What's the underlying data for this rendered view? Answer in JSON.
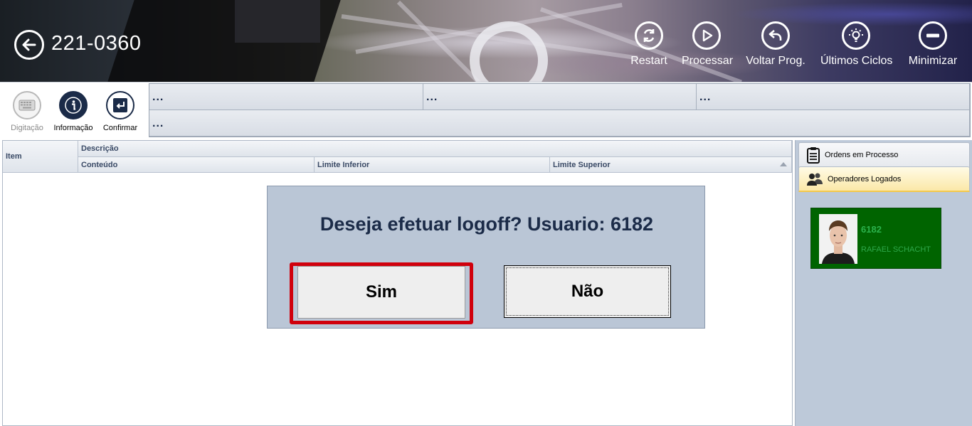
{
  "header": {
    "title": "221-0360",
    "buttons": [
      {
        "label": "Restart",
        "icon": "restart-icon"
      },
      {
        "label": "Processar",
        "icon": "play-icon"
      },
      {
        "label": "Voltar Prog.",
        "icon": "undo-icon"
      },
      {
        "label": "Últimos Ciclos",
        "icon": "lightbulb-icon"
      },
      {
        "label": "Minimizar",
        "icon": "minus-icon"
      }
    ]
  },
  "toolbar": {
    "tools": [
      {
        "label": "Digitação",
        "icon": "keyboard-icon",
        "enabled": false
      },
      {
        "label": "Informação",
        "icon": "info-icon",
        "enabled": true
      },
      {
        "label": "Confirmar",
        "icon": "enter-icon",
        "enabled": true
      }
    ],
    "info_cells": [
      "...",
      "...",
      "...",
      "..."
    ]
  },
  "grid": {
    "columns": {
      "item": "Item",
      "descricao": "Descrição",
      "conteudo": "Conteúdo",
      "limite_inferior": "Limite Inferior",
      "limite_superior": "Limite Superior"
    },
    "rows": []
  },
  "dialog": {
    "message": "Deseja efetuar logoff? Usuario: 6182",
    "yes_label": "Sim",
    "no_label": "Não"
  },
  "right_panel": {
    "tabs": [
      {
        "label": "Ordens em Processo",
        "icon": "clipboard-icon"
      },
      {
        "label": "Operadores Logados",
        "icon": "users-icon"
      }
    ],
    "operators": [
      {
        "id": "6182",
        "name": "RAFAEL SCHACHT"
      }
    ]
  },
  "colors": {
    "dialog_bg": "#bac6d6",
    "highlight_outline": "#d0000c",
    "operator_card_bg": "#006400",
    "operator_text": "#2bb24c"
  }
}
